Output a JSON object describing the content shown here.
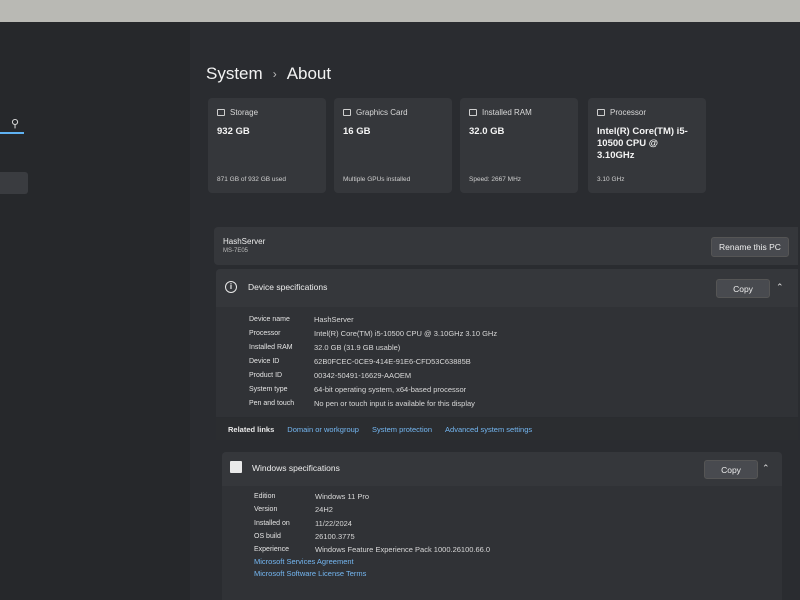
{
  "breadcrumb": {
    "parent": "System",
    "separator": "›",
    "current": "About"
  },
  "cards": [
    {
      "title": "Storage",
      "value": "932 GB",
      "sub": "871 GB of 932 GB used",
      "icon": "storage-icon"
    },
    {
      "title": "Graphics Card",
      "value": "16 GB",
      "sub": "Multiple GPUs installed",
      "icon": "graphics-card-icon"
    },
    {
      "title": "Installed RAM",
      "value": "32.0 GB",
      "sub": "Speed: 2667 MHz",
      "icon": "ram-icon"
    },
    {
      "title": "Processor",
      "value": "Intel(R) Core(TM) i5-10500 CPU @ 3.10GHz",
      "sub": "3.10 GHz",
      "icon": "processor-icon"
    }
  ],
  "pc": {
    "name": "HashServer",
    "model": "MS-7E05",
    "rename_label": "Rename this PC"
  },
  "device_specs": {
    "title": "Device specifications",
    "copy_label": "Copy",
    "rows": [
      {
        "label": "Device name",
        "value": "HashServer"
      },
      {
        "label": "Processor",
        "value": "Intel(R) Core(TM) i5-10500 CPU @ 3.10GHz   3.10 GHz"
      },
      {
        "label": "Installed RAM",
        "value": "32.0 GB (31.9 GB usable)"
      },
      {
        "label": "Device ID",
        "value": "62B0FCEC-0CE9-414E-91E6-CFD53C63885B"
      },
      {
        "label": "Product ID",
        "value": "00342-50491-16629-AAOEM"
      },
      {
        "label": "System type",
        "value": "64-bit operating system, x64-based processor"
      },
      {
        "label": "Pen and touch",
        "value": "No pen or touch input is available for this display"
      }
    ]
  },
  "related": {
    "label": "Related links",
    "links": [
      "Domain or workgroup",
      "System protection",
      "Advanced system settings"
    ]
  },
  "windows_specs": {
    "title": "Windows specifications",
    "copy_label": "Copy",
    "rows": [
      {
        "label": "Edition",
        "value": "Windows 11 Pro"
      },
      {
        "label": "Version",
        "value": "24H2"
      },
      {
        "label": "Installed on",
        "value": "11/22/2024"
      },
      {
        "label": "OS build",
        "value": "26100.3775"
      },
      {
        "label": "Experience",
        "value": "Windows Feature Experience Pack 1000.26100.66.0"
      }
    ],
    "links": [
      "Microsoft Services Agreement",
      "Microsoft Software License Terms"
    ]
  },
  "colors": {
    "accent": "#74b7f2",
    "background": "#2a2c30",
    "card": "#35373b"
  }
}
